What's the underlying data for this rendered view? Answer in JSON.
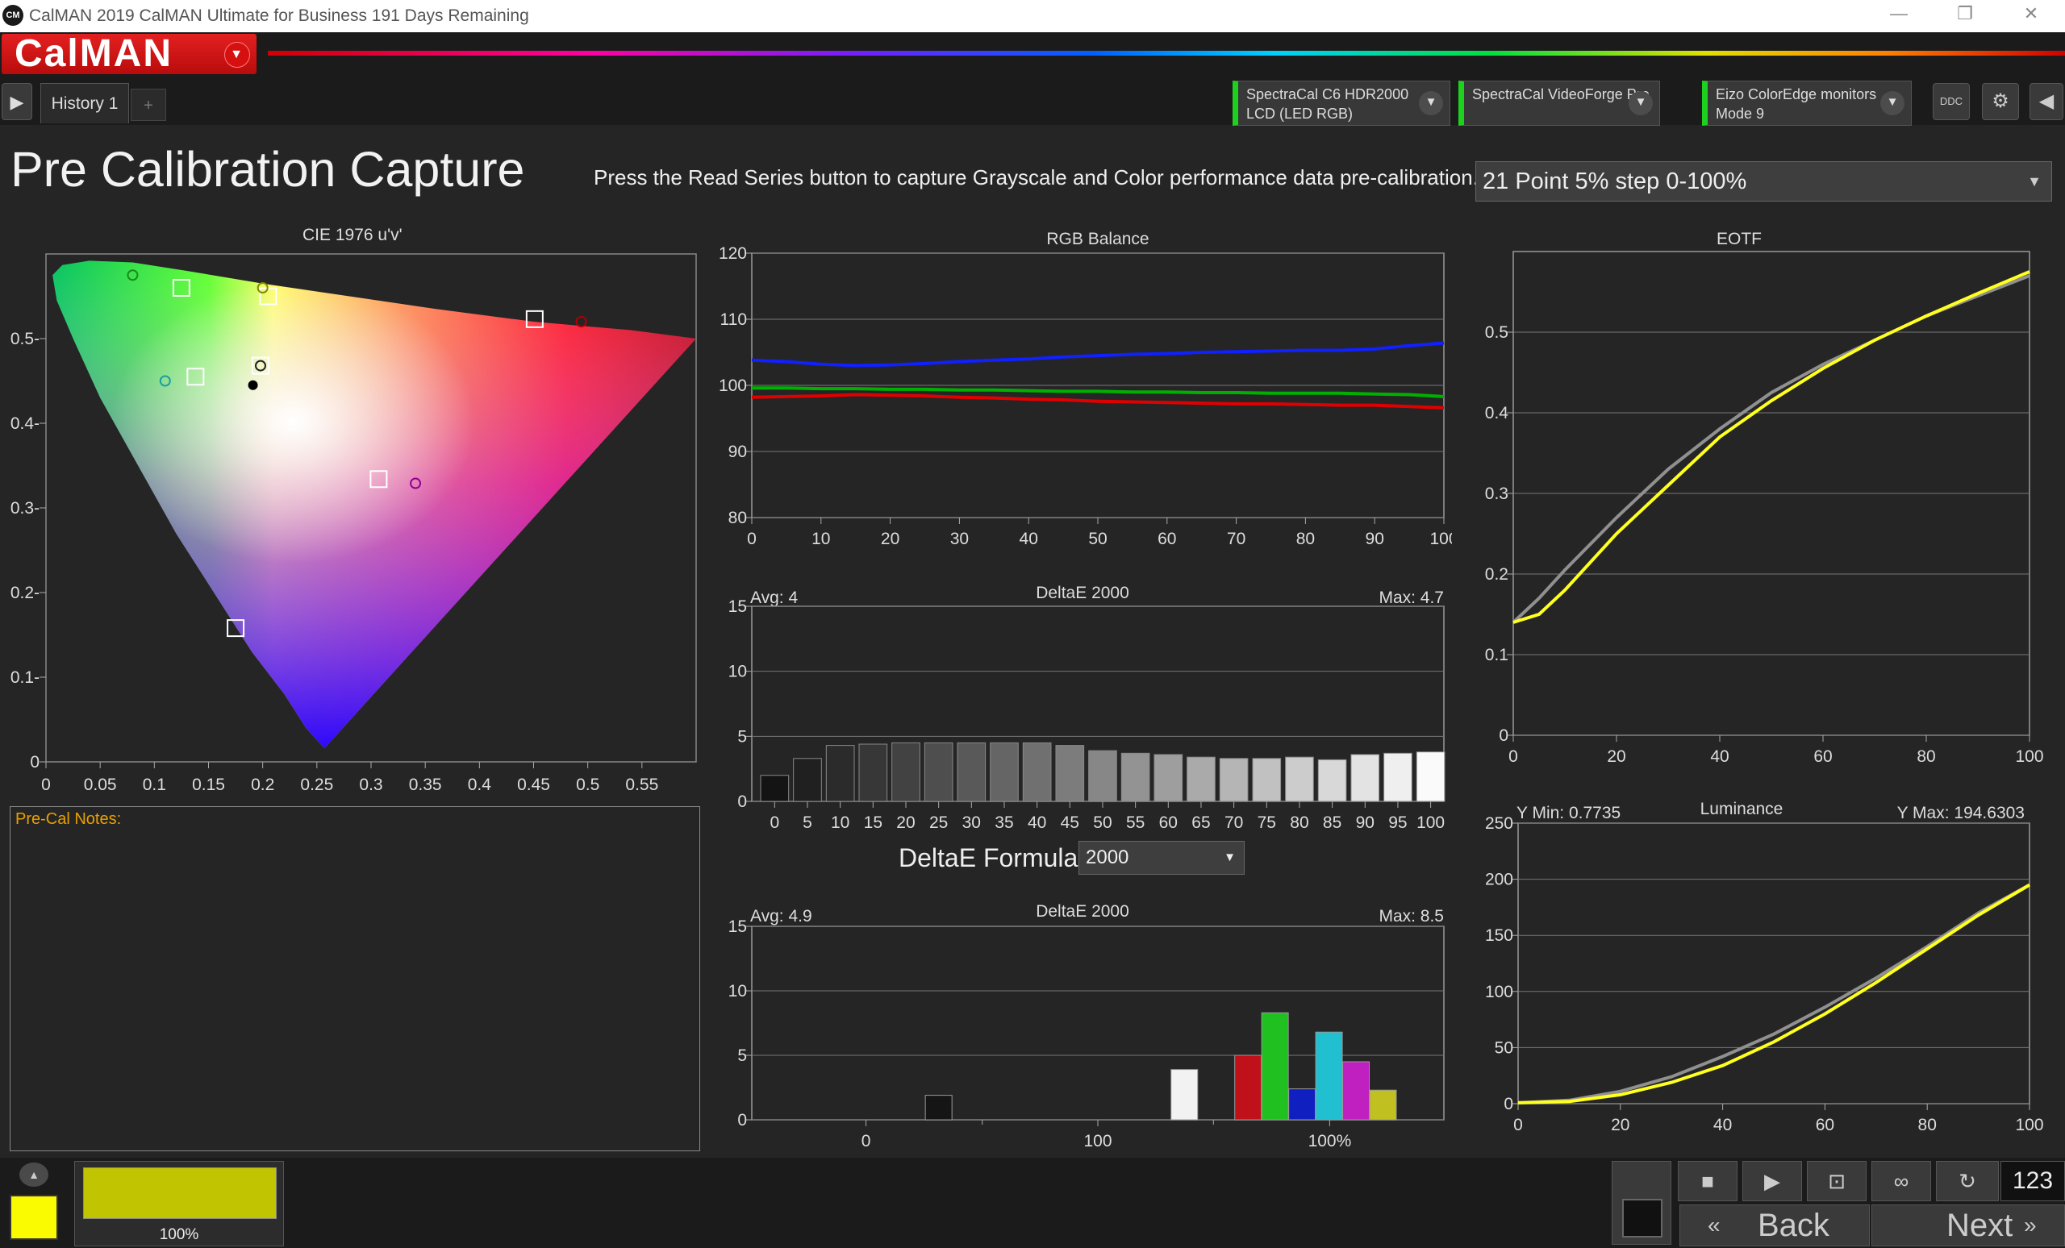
{
  "window": {
    "title": "CalMAN 2019 CalMAN Ultimate for Business 191 Days Remaining",
    "logo": "CM"
  },
  "brand": {
    "name": "CalMAN"
  },
  "tabs": [
    {
      "label": "History 1"
    }
  ],
  "devices": [
    {
      "line1": "SpectraCal C6 HDR2000",
      "line2": "LCD (LED RGB)"
    },
    {
      "line1": "SpectraCal VideoForge Pro",
      "line2": ""
    },
    {
      "line1": "Eizo ColorEdge monitors",
      "line2": "Mode 9"
    }
  ],
  "ddc_label": "DDC",
  "page": {
    "title": "Pre Calibration Capture",
    "instruction": "Press the Read Series button to capture Grayscale and Color performance data pre-calibration.",
    "series_select": "21 Point 5% step 0-100%"
  },
  "notes_label": "Pre-Cal Notes:",
  "deltae_formula": {
    "label": "DeltaE Formula",
    "value": "2000"
  },
  "colors": {
    "red": "#e00000",
    "green": "#00b000",
    "blue": "#1020ff",
    "target_yellow": "#ffff20",
    "reference_gray": "#909090"
  },
  "chart_data": [
    {
      "type": "scatter",
      "title": "CIE 1976 u'v'",
      "xlim": [
        0,
        0.6
      ],
      "ylim": [
        0,
        0.6
      ],
      "xticks": [
        "0",
        "0.05",
        "0.1",
        "0.15",
        "0.2",
        "0.25",
        "0.3",
        "0.35",
        "0.4",
        "0.45",
        "0.5",
        "0.55"
      ],
      "yticks": [
        "0",
        "0.1-",
        "0.2-",
        "0.3-",
        "0.4-",
        "0.5-"
      ],
      "targets": [
        [
          0.125,
          0.56
        ],
        [
          0.205,
          0.55
        ],
        [
          0.451,
          0.523
        ],
        [
          0.138,
          0.455
        ],
        [
          0.198,
          0.468
        ],
        [
          0.307,
          0.334
        ],
        [
          0.175,
          0.158
        ]
      ],
      "measured": [
        [
          0.08,
          0.575,
          "#1a8c1a"
        ],
        [
          0.2,
          0.56,
          "#888800"
        ],
        [
          0.494,
          0.52,
          "#b00000"
        ],
        [
          0.11,
          0.45,
          "#1aa0a0"
        ],
        [
          0.198,
          0.468,
          "#222222"
        ],
        [
          0.341,
          0.329,
          "#900090"
        ]
      ],
      "whitepoint": [
        0.191,
        0.445
      ]
    },
    {
      "type": "line",
      "title": "RGB Balance",
      "x": [
        0,
        5,
        10,
        15,
        20,
        25,
        30,
        35,
        40,
        45,
        50,
        55,
        60,
        65,
        70,
        75,
        80,
        85,
        90,
        95,
        100
      ],
      "ylim": [
        80,
        120
      ],
      "yticks": [
        "80",
        "90",
        "100",
        "110",
        "120"
      ],
      "xticks": [
        "0",
        "10",
        "20",
        "30",
        "40",
        "50",
        "60",
        "70",
        "80",
        "90",
        "100"
      ],
      "series": [
        {
          "color": "#1020ff",
          "values": [
            103.8,
            103.6,
            103.2,
            103.0,
            103.1,
            103.3,
            103.6,
            103.8,
            104.0,
            104.3,
            104.5,
            104.7,
            104.8,
            105.0,
            105.1,
            105.2,
            105.3,
            105.3,
            105.5,
            106.0,
            106.4
          ]
        },
        {
          "color": "#00b000",
          "values": [
            99.6,
            99.6,
            99.5,
            99.5,
            99.4,
            99.4,
            99.3,
            99.3,
            99.2,
            99.1,
            99.1,
            99.0,
            99.0,
            98.9,
            98.9,
            98.8,
            98.8,
            98.8,
            98.7,
            98.6,
            98.3
          ]
        },
        {
          "color": "#e00000",
          "values": [
            98.2,
            98.3,
            98.4,
            98.6,
            98.5,
            98.4,
            98.2,
            98.1,
            97.9,
            97.8,
            97.6,
            97.5,
            97.4,
            97.3,
            97.2,
            97.2,
            97.1,
            97.0,
            97.0,
            96.8,
            96.6
          ]
        }
      ]
    },
    {
      "type": "bar",
      "title": "DeltaE 2000",
      "avg": "Avg: 4",
      "max": "Max: 4.7",
      "categories": [
        "0",
        "5",
        "10",
        "15",
        "20",
        "25",
        "30",
        "35",
        "40",
        "45",
        "50",
        "55",
        "60",
        "65",
        "70",
        "75",
        "80",
        "85",
        "90",
        "95",
        "100"
      ],
      "values": [
        2.0,
        3.3,
        4.3,
        4.4,
        4.5,
        4.5,
        4.5,
        4.5,
        4.5,
        4.3,
        3.9,
        3.7,
        3.6,
        3.4,
        3.3,
        3.3,
        3.4,
        3.2,
        3.6,
        3.7,
        3.8
      ],
      "ylim": [
        0,
        15
      ],
      "yticks": [
        "0",
        "5",
        "10",
        "15"
      ]
    },
    {
      "type": "bar",
      "title": "DeltaE 2000",
      "avg": "Avg: 4.9",
      "max": "Max: 8.5",
      "ylim": [
        0,
        15
      ],
      "yticks": [
        "0",
        "5",
        "10",
        "15"
      ],
      "xlabels": [
        "0",
        "100",
        "100%"
      ],
      "bars": [
        {
          "pos": 0.27,
          "value": 1.9,
          "color": "#151515"
        },
        {
          "pos": 0.625,
          "value": 3.9,
          "color": "#f2f2f2"
        },
        {
          "pos": 0.717,
          "value": 5.0,
          "color": "#c0101a"
        },
        {
          "pos": 0.756,
          "value": 8.3,
          "color": "#20c020"
        },
        {
          "pos": 0.795,
          "value": 2.4,
          "color": "#1020c0"
        },
        {
          "pos": 0.834,
          "value": 6.8,
          "color": "#20c0d0"
        },
        {
          "pos": 0.873,
          "value": 4.5,
          "color": "#c020c0"
        },
        {
          "pos": 0.912,
          "value": 2.3,
          "color": "#c0c020"
        }
      ]
    },
    {
      "type": "line",
      "title": "EOTF",
      "xlim": [
        0,
        100
      ],
      "ylim": [
        0,
        0.6
      ],
      "xticks": [
        "0",
        "20",
        "40",
        "60",
        "80",
        "100"
      ],
      "yticks": [
        "0",
        "0.1",
        "0.2",
        "0.3",
        "0.4",
        "0.5"
      ],
      "series": [
        {
          "color": "#909090",
          "x": [
            0,
            5,
            10,
            20,
            30,
            40,
            50,
            60,
            70,
            80,
            90,
            100
          ],
          "values": [
            0.14,
            0.17,
            0.205,
            0.27,
            0.33,
            0.38,
            0.425,
            0.46,
            0.49,
            0.52,
            0.545,
            0.57
          ]
        },
        {
          "color": "#ffff20",
          "x": [
            0,
            5,
            10,
            20,
            30,
            40,
            50,
            60,
            70,
            80,
            90,
            100
          ],
          "values": [
            0.14,
            0.15,
            0.18,
            0.25,
            0.31,
            0.37,
            0.415,
            0.455,
            0.49,
            0.52,
            0.548,
            0.575
          ]
        }
      ]
    },
    {
      "type": "line",
      "title": "Luminance",
      "ymin_label": "Y Min: 0.7735",
      "ymax_label": "Y Max: 194.6303",
      "xlim": [
        0,
        100
      ],
      "ylim": [
        0,
        250
      ],
      "xticks": [
        "0",
        "20",
        "40",
        "60",
        "80",
        "100"
      ],
      "yticks": [
        "0",
        "50",
        "100",
        "150",
        "200",
        "250"
      ],
      "series": [
        {
          "color": "#909090",
          "x": [
            0,
            10,
            20,
            30,
            40,
            50,
            60,
            70,
            80,
            90,
            100
          ],
          "values": [
            0.8,
            3,
            11,
            24,
            42,
            62,
            86,
            112,
            140,
            170,
            195
          ]
        },
        {
          "color": "#ffff20",
          "x": [
            0,
            10,
            20,
            30,
            40,
            50,
            60,
            70,
            80,
            90,
            100
          ],
          "values": [
            0.8,
            2,
            8,
            19,
            34,
            55,
            80,
            108,
            138,
            168,
            195
          ]
        }
      ]
    }
  ],
  "bottom": {
    "swatch_percent": "100%",
    "back_label": "Back",
    "next_label": "Next",
    "counter": "123"
  }
}
